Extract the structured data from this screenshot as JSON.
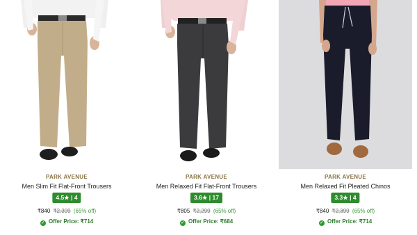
{
  "products": [
    {
      "brand": "PARK AVENUE",
      "title": "Men Slim Fit Flat-Front Trousers",
      "rating": "4.5★ | 4",
      "price": "₹840",
      "mrp": "₹2,399",
      "discount": "(65% off)",
      "offer_price": "Offer Price: ₹714"
    },
    {
      "brand": "PARK AVENUE",
      "title": "Men Relaxed Fit Flat-Front Trousers",
      "rating": "3.6★ | 17",
      "price": "₹805",
      "mrp": "₹2,299",
      "discount": "(65% off)",
      "offer_price": "Offer Price: ₹684"
    },
    {
      "brand": "PARK AVENUE",
      "title": "Men Relaxed Fit Pleated Chinos",
      "rating": "3.3★ | 4",
      "price": "₹840",
      "mrp": "₹2,399",
      "discount": "(65% off)",
      "offer_price": "Offer Price: ₹714"
    }
  ],
  "colors": {
    "brand": "#8a7345",
    "rating_bg": "#2e8b2e",
    "offer": "#2e7d2e",
    "khaki": "#c2ad8a",
    "charcoal": "#3b3b3d",
    "navy": "#1a1c2c"
  }
}
